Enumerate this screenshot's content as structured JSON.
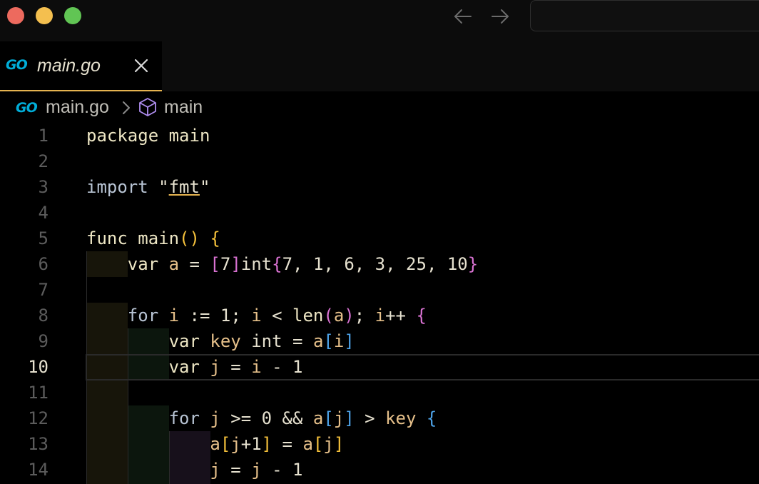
{
  "window": {
    "search_placeholder": ""
  },
  "tab": {
    "logo": "GO",
    "label": "main.go"
  },
  "breadcrumb": {
    "logo": "GO",
    "file": "main.go",
    "symbol": "main"
  },
  "editor": {
    "active_line": 10,
    "line_numbers": [
      "1",
      "2",
      "3",
      "4",
      "5",
      "6",
      "7",
      "8",
      "9",
      "10",
      "11",
      "12",
      "13",
      "14"
    ]
  },
  "colors": {
    "accent": "#e6b450",
    "go_blue": "#00add8",
    "bracket_level1": "#f5c13b",
    "bracket_level2": "#d972d2",
    "bracket_level3": "#4ea3e8"
  },
  "icons": {
    "close": "close-icon",
    "back": "arrow-left-icon",
    "forward": "arrow-right-icon",
    "separator": "chevron-right-icon",
    "symbol": "cube-icon"
  }
}
